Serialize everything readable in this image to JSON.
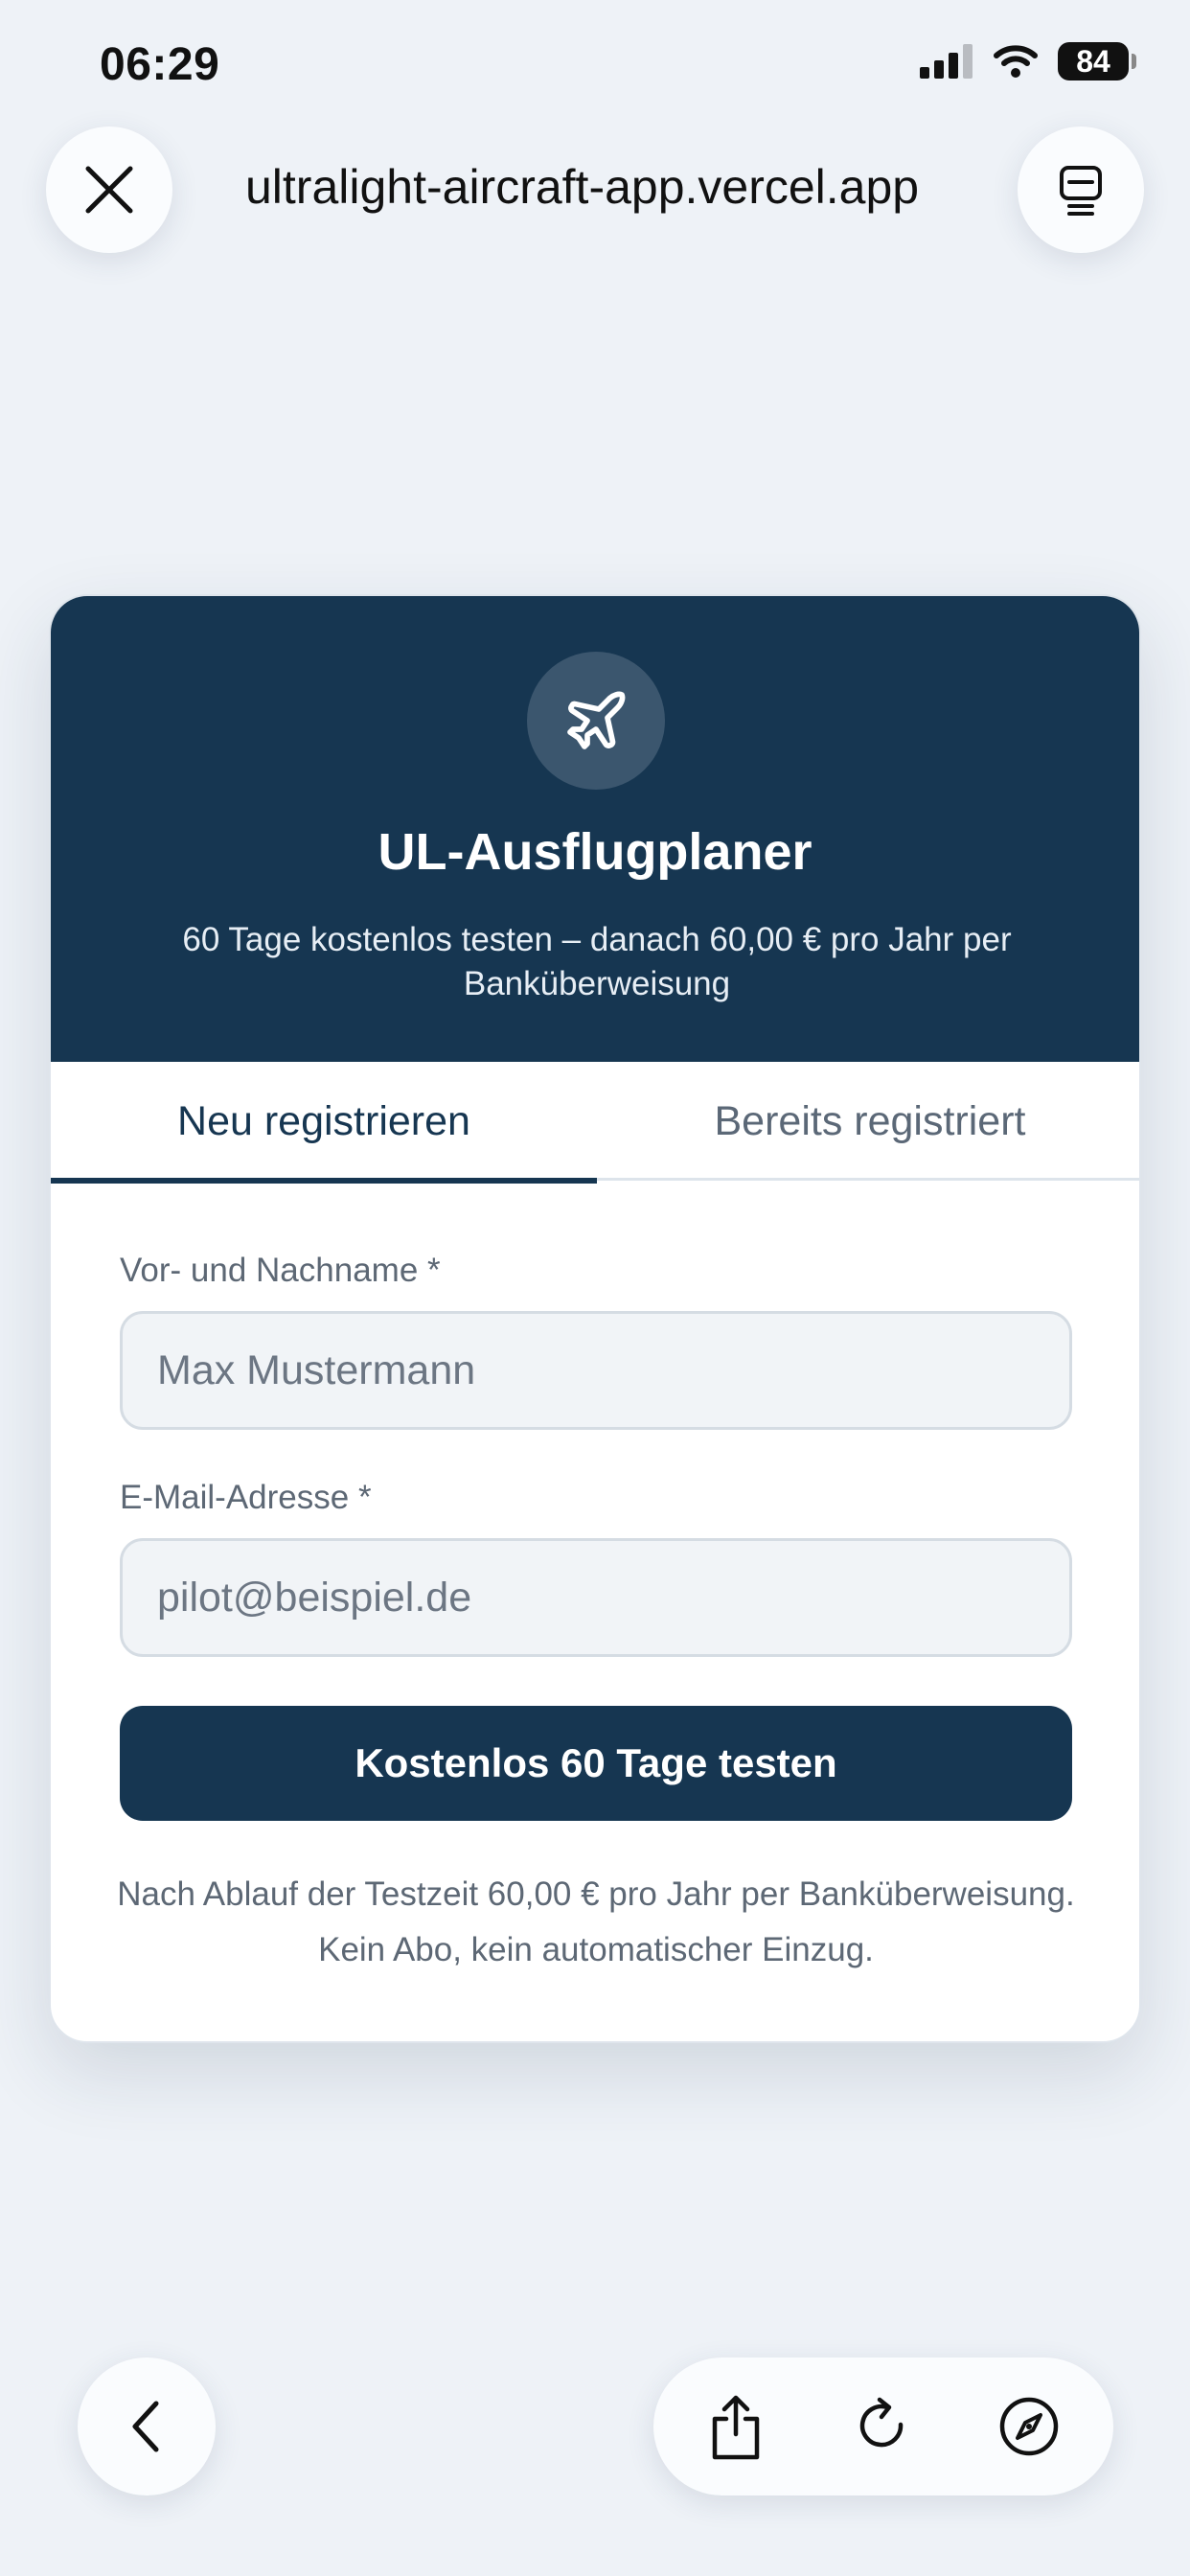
{
  "status_bar": {
    "time": "06:29",
    "battery": "84"
  },
  "browser": {
    "url": "ultralight-aircraft-app.vercel.app"
  },
  "app": {
    "title": "UL-Ausflugplaner",
    "subtitle": "60 Tage kostenlos testen – danach 60,00 € pro Jahr per Banküberweisung",
    "logo_icon": "airplane-icon"
  },
  "tabs": [
    {
      "label": "Neu registrieren",
      "active": true
    },
    {
      "label": "Bereits registriert",
      "active": false
    }
  ],
  "form": {
    "name_label": "Vor- und Nachname *",
    "name_placeholder": "Max Mustermann",
    "email_label": "E-Mail-Adresse *",
    "email_placeholder": "pilot@beispiel.de",
    "submit_label": "Kostenlos 60 Tage testen",
    "note": "Nach Ablauf der Testzeit 60,00 € pro Jahr per Banküberweisung. Kein Abo, kein automatischer Einzug."
  },
  "colors": {
    "brand": "#163651",
    "background": "#eef2f7"
  }
}
